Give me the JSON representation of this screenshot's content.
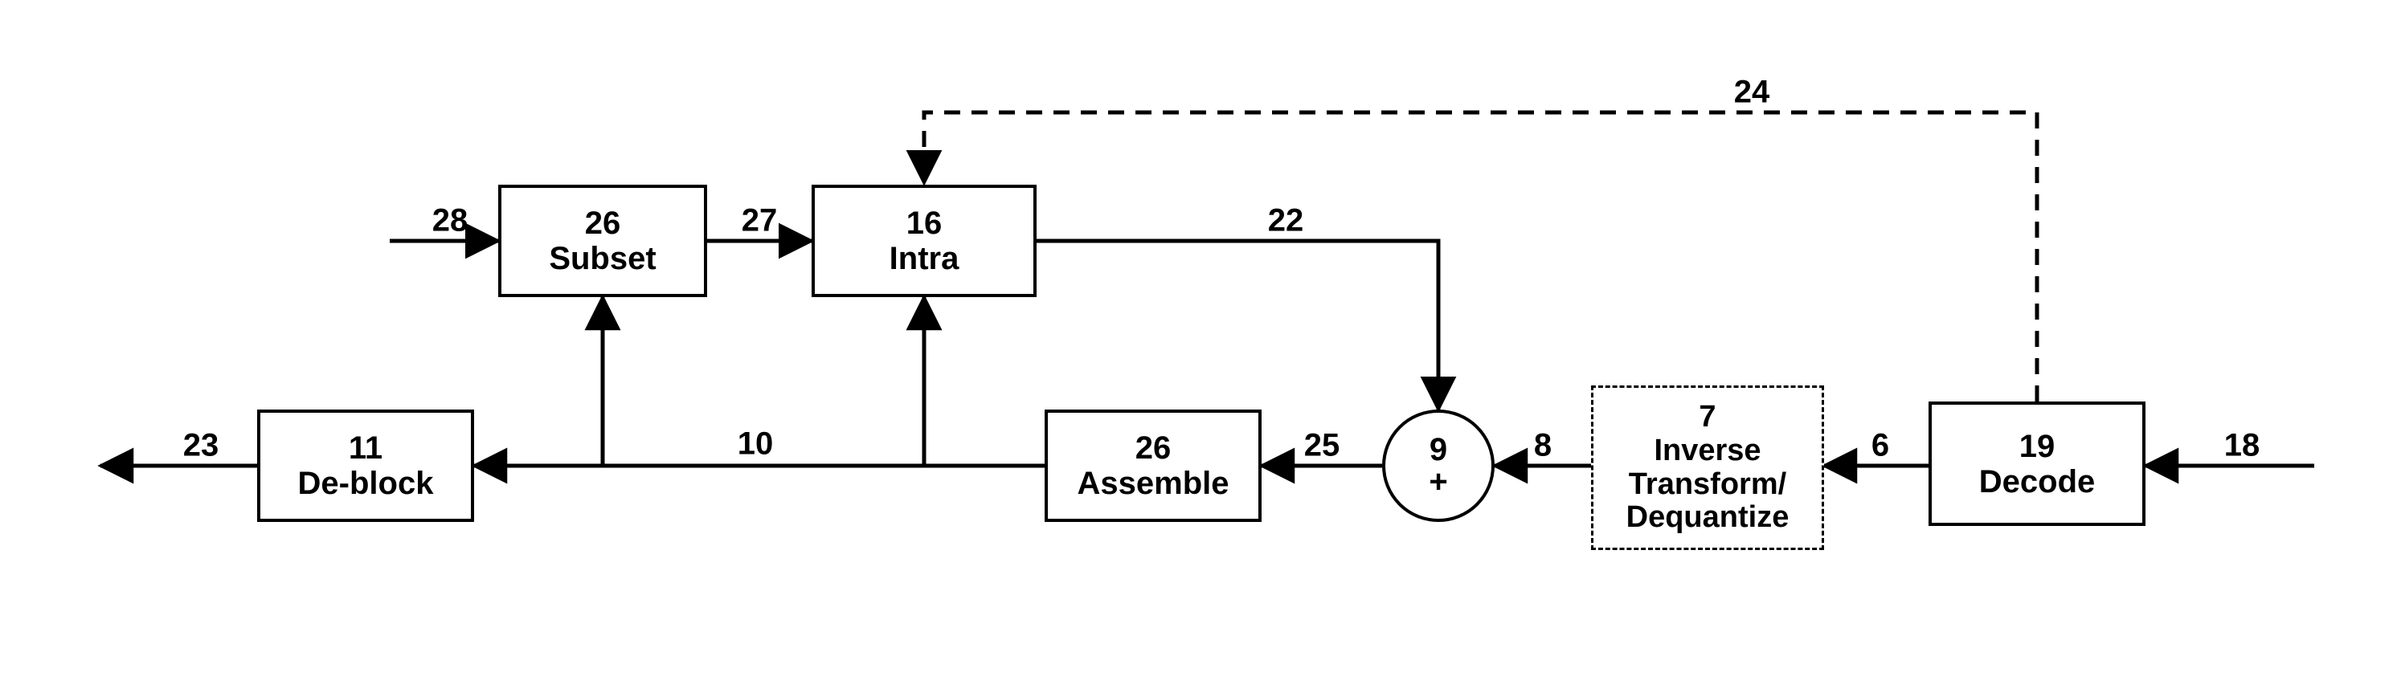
{
  "blocks": {
    "subset": {
      "num": "26",
      "name": "Subset"
    },
    "intra": {
      "num": "16",
      "name": "Intra"
    },
    "deblock": {
      "num": "11",
      "name": "De-block"
    },
    "assemble": {
      "num": "26",
      "name": "Assemble"
    },
    "invtrans": {
      "num": "7",
      "name1": "Inverse",
      "name2": "Transform/",
      "name3": "Dequantize"
    },
    "decode": {
      "num": "19",
      "name": "Decode"
    },
    "adder": {
      "num": "9",
      "sym": "+"
    }
  },
  "wires": {
    "w18": "18",
    "w6": "6",
    "w8": "8",
    "w25": "25",
    "w22": "22",
    "w27": "27",
    "w28": "28",
    "w10": "10",
    "w23": "23",
    "w24": "24"
  }
}
